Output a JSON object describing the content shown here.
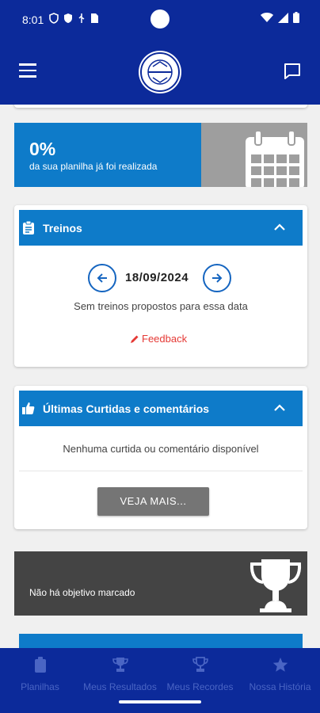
{
  "status_bar": {
    "time": "8:01"
  },
  "progress": {
    "percent": "0%",
    "description": "da sua planilha já foi realizada"
  },
  "treinos": {
    "title": "Treinos",
    "date": "18/09/2024",
    "empty_message": "Sem treinos propostos para essa data",
    "feedback_label": "Feedback"
  },
  "curtidas": {
    "title": "Últimas Curtidas e comentários",
    "empty_message": "Nenhuma curtida ou comentário disponível",
    "more_button": "VEJA MAIS..."
  },
  "objective": {
    "message": "Não há objetivo marcado"
  },
  "bottom_nav": {
    "items": [
      {
        "label": "Planilhas",
        "icon": "clipboard-icon"
      },
      {
        "label": "Meus Resultados",
        "icon": "trophy-icon"
      },
      {
        "label": "Meus Recordes",
        "icon": "trophy-outline-icon"
      },
      {
        "label": "Nossa História",
        "icon": "star-icon"
      }
    ]
  },
  "colors": {
    "primary": "#0c2a9a",
    "accent_blue": "#0e7bc9",
    "nav_inactive": "#4a65c4",
    "feedback_red": "#e53935",
    "objective_bg": "#444444"
  }
}
